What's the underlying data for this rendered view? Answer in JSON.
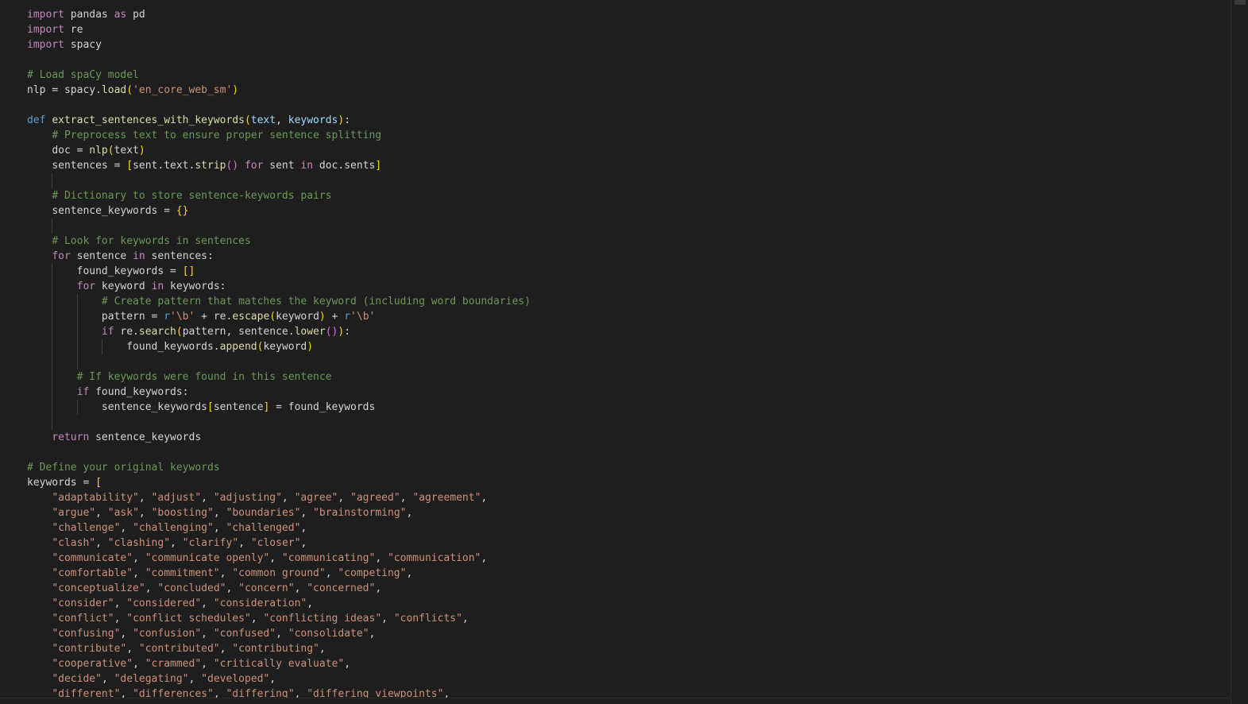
{
  "editor": {
    "language": "Python",
    "colors": {
      "background": "#1e1e1e",
      "default_text": "#d4d4d4",
      "keyword": "#569cd6",
      "control_keyword": "#c586c0",
      "function": "#dcdcaa",
      "parameter": "#9cdcfe",
      "string": "#ce9178",
      "comment": "#6a9955",
      "bracket_level_1": "#ffd700",
      "bracket_level_2": "#da70d6",
      "bracket_level_3": "#179fff"
    },
    "lines": [
      {
        "indent": 0,
        "tokens": [
          [
            "import",
            "ctl"
          ],
          [
            " pandas ",
            ""
          ],
          [
            "as",
            "ctl"
          ],
          [
            " pd",
            ""
          ]
        ]
      },
      {
        "indent": 0,
        "tokens": [
          [
            "import",
            "ctl"
          ],
          [
            " re",
            ""
          ]
        ]
      },
      {
        "indent": 0,
        "tokens": [
          [
            "import",
            "ctl"
          ],
          [
            " spacy",
            ""
          ]
        ]
      },
      {
        "indent": 0,
        "tokens": []
      },
      {
        "indent": 0,
        "tokens": [
          [
            "# Load spaCy model",
            "cm"
          ]
        ]
      },
      {
        "indent": 0,
        "tokens": [
          [
            "nlp = spacy.",
            ""
          ],
          [
            "load",
            "fn"
          ],
          [
            "(",
            "b1"
          ],
          [
            "'en_core_web_sm'",
            "str"
          ],
          [
            ")",
            "b1"
          ]
        ]
      },
      {
        "indent": 0,
        "tokens": []
      },
      {
        "indent": 0,
        "tokens": [
          [
            "def",
            "kw"
          ],
          [
            " ",
            ""
          ],
          [
            "extract_sentences_with_keywords",
            "fn"
          ],
          [
            "(",
            "b1"
          ],
          [
            "text",
            "par"
          ],
          [
            ", ",
            ""
          ],
          [
            "keywords",
            "par"
          ],
          [
            ")",
            "b1"
          ],
          [
            ":",
            ""
          ]
        ]
      },
      {
        "indent": 1,
        "tokens": [
          [
            "# Preprocess text to ensure proper sentence splitting",
            "cm"
          ]
        ]
      },
      {
        "indent": 1,
        "tokens": [
          [
            "doc = ",
            ""
          ],
          [
            "nlp",
            "fn"
          ],
          [
            "(",
            "b1"
          ],
          [
            "text",
            ""
          ],
          [
            ")",
            "b1"
          ]
        ]
      },
      {
        "indent": 1,
        "tokens": [
          [
            "sentences = ",
            ""
          ],
          [
            "[",
            "b1"
          ],
          [
            "sent.text.",
            ""
          ],
          [
            "strip",
            "fn"
          ],
          [
            "()",
            "b2"
          ],
          [
            " ",
            ""
          ],
          [
            "for",
            "ctl"
          ],
          [
            " sent ",
            ""
          ],
          [
            "in",
            "ctl"
          ],
          [
            " doc.sents",
            ""
          ],
          [
            "]",
            "b1"
          ]
        ]
      },
      {
        "indent": 1,
        "guides": 1,
        "tokens": []
      },
      {
        "indent": 1,
        "tokens": [
          [
            "# Dictionary to store sentence-keywords pairs",
            "cm"
          ]
        ]
      },
      {
        "indent": 1,
        "tokens": [
          [
            "sentence_keywords = ",
            ""
          ],
          [
            "{}",
            "b1"
          ]
        ]
      },
      {
        "indent": 1,
        "guides": 1,
        "tokens": []
      },
      {
        "indent": 1,
        "tokens": [
          [
            "# Look for keywords in sentences",
            "cm"
          ]
        ]
      },
      {
        "indent": 1,
        "tokens": [
          [
            "for",
            "ctl"
          ],
          [
            " sentence ",
            ""
          ],
          [
            "in",
            "ctl"
          ],
          [
            " sentences:",
            ""
          ]
        ]
      },
      {
        "indent": 2,
        "tokens": [
          [
            "found_keywords = ",
            ""
          ],
          [
            "[]",
            "b1"
          ]
        ]
      },
      {
        "indent": 2,
        "tokens": [
          [
            "for",
            "ctl"
          ],
          [
            " keyword ",
            ""
          ],
          [
            "in",
            "ctl"
          ],
          [
            " keywords:",
            ""
          ]
        ]
      },
      {
        "indent": 3,
        "tokens": [
          [
            "# Create pattern that matches the keyword (including word boundaries)",
            "cm"
          ]
        ]
      },
      {
        "indent": 3,
        "tokens": [
          [
            "pattern = ",
            ""
          ],
          [
            "r",
            "rx"
          ],
          [
            "'\\b'",
            "str"
          ],
          [
            " + re.",
            ""
          ],
          [
            "escape",
            "fn"
          ],
          [
            "(",
            "b1"
          ],
          [
            "keyword",
            ""
          ],
          [
            ")",
            "b1"
          ],
          [
            " + ",
            ""
          ],
          [
            "r",
            "rx"
          ],
          [
            "'\\b'",
            "str"
          ]
        ]
      },
      {
        "indent": 3,
        "tokens": [
          [
            "if",
            "ctl"
          ],
          [
            " re.",
            ""
          ],
          [
            "search",
            "fn"
          ],
          [
            "(",
            "b1"
          ],
          [
            "pattern, sentence.",
            ""
          ],
          [
            "lower",
            "fn"
          ],
          [
            "()",
            "b2"
          ],
          [
            ")",
            "b1"
          ],
          [
            ":",
            ""
          ]
        ]
      },
      {
        "indent": 4,
        "tokens": [
          [
            "found_keywords.",
            ""
          ],
          [
            "append",
            "fn"
          ],
          [
            "(",
            "b1"
          ],
          [
            "keyword",
            ""
          ],
          [
            ")",
            "b1"
          ]
        ]
      },
      {
        "indent": 2,
        "guides": 2,
        "tokens": []
      },
      {
        "indent": 2,
        "tokens": [
          [
            "# If keywords were found in this sentence",
            "cm"
          ]
        ]
      },
      {
        "indent": 2,
        "tokens": [
          [
            "if",
            "ctl"
          ],
          [
            " found_keywords:",
            ""
          ]
        ]
      },
      {
        "indent": 3,
        "tokens": [
          [
            "sentence_keywords",
            ""
          ],
          [
            "[",
            "b1"
          ],
          [
            "sentence",
            ""
          ],
          [
            "]",
            "b1"
          ],
          [
            " = found_keywords",
            ""
          ]
        ]
      },
      {
        "indent": 1,
        "guides": 1,
        "tokens": []
      },
      {
        "indent": 1,
        "tokens": [
          [
            "return",
            "ctl"
          ],
          [
            " sentence_keywords",
            ""
          ]
        ]
      },
      {
        "indent": 0,
        "tokens": []
      },
      {
        "indent": 0,
        "tokens": [
          [
            "# Define your original keywords",
            "cm"
          ]
        ]
      },
      {
        "indent": 0,
        "tokens": [
          [
            "keywords = ",
            ""
          ],
          [
            "[",
            "b1"
          ]
        ]
      },
      {
        "indent": 1,
        "tokens": [
          [
            "\"adaptability\"",
            "str"
          ],
          [
            ", ",
            ""
          ],
          [
            "\"adjust\"",
            "str"
          ],
          [
            ", ",
            ""
          ],
          [
            "\"adjusting\"",
            "str"
          ],
          [
            ", ",
            ""
          ],
          [
            "\"agree\"",
            "str"
          ],
          [
            ", ",
            ""
          ],
          [
            "\"agreed\"",
            "str"
          ],
          [
            ", ",
            ""
          ],
          [
            "\"agreement\"",
            "str"
          ],
          [
            ",",
            ""
          ]
        ]
      },
      {
        "indent": 1,
        "tokens": [
          [
            "\"argue\"",
            "str"
          ],
          [
            ", ",
            ""
          ],
          [
            "\"ask\"",
            "str"
          ],
          [
            ", ",
            ""
          ],
          [
            "\"boosting\"",
            "str"
          ],
          [
            ", ",
            ""
          ],
          [
            "\"boundaries\"",
            "str"
          ],
          [
            ", ",
            ""
          ],
          [
            "\"brainstorming\"",
            "str"
          ],
          [
            ",",
            ""
          ]
        ]
      },
      {
        "indent": 1,
        "tokens": [
          [
            "\"challenge\"",
            "str"
          ],
          [
            ", ",
            ""
          ],
          [
            "\"challenging\"",
            "str"
          ],
          [
            ", ",
            ""
          ],
          [
            "\"challenged\"",
            "str"
          ],
          [
            ",",
            ""
          ]
        ]
      },
      {
        "indent": 1,
        "tokens": [
          [
            "\"clash\"",
            "str"
          ],
          [
            ", ",
            ""
          ],
          [
            "\"clashing\"",
            "str"
          ],
          [
            ", ",
            ""
          ],
          [
            "\"clarify\"",
            "str"
          ],
          [
            ", ",
            ""
          ],
          [
            "\"closer\"",
            "str"
          ],
          [
            ",",
            ""
          ]
        ]
      },
      {
        "indent": 1,
        "tokens": [
          [
            "\"communicate\"",
            "str"
          ],
          [
            ", ",
            ""
          ],
          [
            "\"communicate openly\"",
            "str"
          ],
          [
            ", ",
            ""
          ],
          [
            "\"communicating\"",
            "str"
          ],
          [
            ", ",
            ""
          ],
          [
            "\"communication\"",
            "str"
          ],
          [
            ",",
            ""
          ]
        ]
      },
      {
        "indent": 1,
        "tokens": [
          [
            "\"comfortable\"",
            "str"
          ],
          [
            ", ",
            ""
          ],
          [
            "\"commitment\"",
            "str"
          ],
          [
            ", ",
            ""
          ],
          [
            "\"common ground\"",
            "str"
          ],
          [
            ", ",
            ""
          ],
          [
            "\"competing\"",
            "str"
          ],
          [
            ",",
            ""
          ]
        ]
      },
      {
        "indent": 1,
        "tokens": [
          [
            "\"conceptualize\"",
            "str"
          ],
          [
            ", ",
            ""
          ],
          [
            "\"concluded\"",
            "str"
          ],
          [
            ", ",
            ""
          ],
          [
            "\"concern\"",
            "str"
          ],
          [
            ", ",
            ""
          ],
          [
            "\"concerned\"",
            "str"
          ],
          [
            ",",
            ""
          ]
        ]
      },
      {
        "indent": 1,
        "tokens": [
          [
            "\"consider\"",
            "str"
          ],
          [
            ", ",
            ""
          ],
          [
            "\"considered\"",
            "str"
          ],
          [
            ", ",
            ""
          ],
          [
            "\"consideration\"",
            "str"
          ],
          [
            ",",
            ""
          ]
        ]
      },
      {
        "indent": 1,
        "tokens": [
          [
            "\"conflict\"",
            "str"
          ],
          [
            ", ",
            ""
          ],
          [
            "\"conflict schedules\"",
            "str"
          ],
          [
            ", ",
            ""
          ],
          [
            "\"conflicting ideas\"",
            "str"
          ],
          [
            ", ",
            ""
          ],
          [
            "\"conflicts\"",
            "str"
          ],
          [
            ",",
            ""
          ]
        ]
      },
      {
        "indent": 1,
        "tokens": [
          [
            "\"confusing\"",
            "str"
          ],
          [
            ", ",
            ""
          ],
          [
            "\"confusion\"",
            "str"
          ],
          [
            ", ",
            ""
          ],
          [
            "\"confused\"",
            "str"
          ],
          [
            ", ",
            ""
          ],
          [
            "\"consolidate\"",
            "str"
          ],
          [
            ",",
            ""
          ]
        ]
      },
      {
        "indent": 1,
        "tokens": [
          [
            "\"contribute\"",
            "str"
          ],
          [
            ", ",
            ""
          ],
          [
            "\"contributed\"",
            "str"
          ],
          [
            ", ",
            ""
          ],
          [
            "\"contributing\"",
            "str"
          ],
          [
            ",",
            ""
          ]
        ]
      },
      {
        "indent": 1,
        "tokens": [
          [
            "\"cooperative\"",
            "str"
          ],
          [
            ", ",
            ""
          ],
          [
            "\"crammed\"",
            "str"
          ],
          [
            ", ",
            ""
          ],
          [
            "\"critically evaluate\"",
            "str"
          ],
          [
            ",",
            ""
          ]
        ]
      },
      {
        "indent": 1,
        "tokens": [
          [
            "\"decide\"",
            "str"
          ],
          [
            ", ",
            ""
          ],
          [
            "\"delegating\"",
            "str"
          ],
          [
            ", ",
            ""
          ],
          [
            "\"developed\"",
            "str"
          ],
          [
            ",",
            ""
          ]
        ]
      },
      {
        "indent": 1,
        "tokens": [
          [
            "\"different\"",
            "str"
          ],
          [
            ", ",
            ""
          ],
          [
            "\"differences\"",
            "str"
          ],
          [
            ", ",
            ""
          ],
          [
            "\"differing\"",
            "str"
          ],
          [
            ", ",
            ""
          ],
          [
            "\"differing viewpoints\"",
            "str"
          ],
          [
            ",",
            ""
          ]
        ]
      }
    ]
  }
}
